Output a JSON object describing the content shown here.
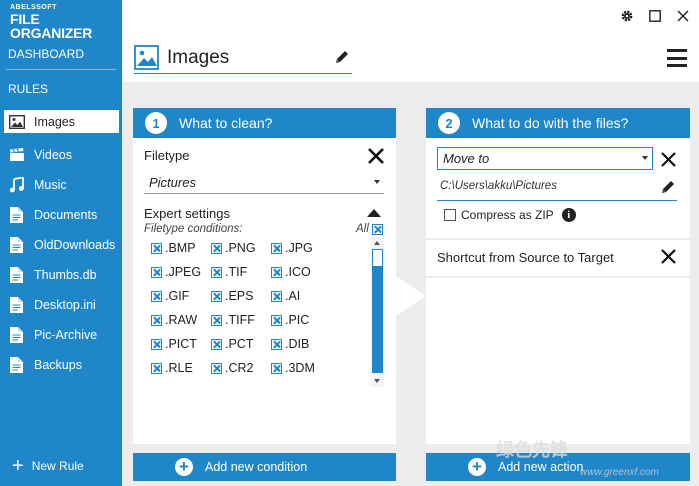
{
  "logo": {
    "small": "ABELSSOFT",
    "big": "FILE ORGANIZER"
  },
  "sidebar": {
    "dashboard": "DASHBOARD",
    "rules_header": "RULES",
    "items": [
      {
        "label": "Images",
        "icon": "image-icon",
        "active": true
      },
      {
        "label": "Videos",
        "icon": "clapper-icon"
      },
      {
        "label": "Music",
        "icon": "music-note-icon"
      },
      {
        "label": "Documents",
        "icon": "document-icon"
      },
      {
        "label": "OldDownloads",
        "icon": "document-icon"
      },
      {
        "label": "Thumbs.db",
        "icon": "document-icon"
      },
      {
        "label": "Desktop.ini",
        "icon": "document-icon"
      },
      {
        "label": "Pic-Archive",
        "icon": "document-icon"
      },
      {
        "label": "Backups",
        "icon": "document-icon"
      }
    ],
    "new_rule": "New Rule"
  },
  "header": {
    "title": "Images"
  },
  "what_to_clean": {
    "number": "1",
    "title": "What to clean?",
    "filetype_label": "Filetype",
    "filetype_value": "Pictures",
    "expert_label": "Expert settings",
    "conditions_label": "Filetype conditions:",
    "all_label": "All",
    "extensions": [
      ".BMP",
      ".PNG",
      ".JPG",
      ".JPEG",
      ".TIF",
      ".ICO",
      ".GIF",
      ".EPS",
      ".AI",
      ".RAW",
      ".TIFF",
      ".PIC",
      ".PICT",
      ".PCT",
      ".DIB",
      ".RLE",
      ".CR2",
      ".3DM"
    ],
    "add_button": "Add new condition"
  },
  "what_to_do": {
    "number": "2",
    "title": "What to do with the files?",
    "action_value": "Move to",
    "path": "C:\\Users\\akku\\Pictures",
    "compress_label": "Compress as ZIP",
    "info_glyph": "i",
    "shortcut_label": "Shortcut from Source to Target",
    "add_button": "Add new action"
  },
  "watermark": {
    "text": "绿色先锋",
    "url": "www.greenxf.com"
  },
  "colors": {
    "accent": "#1f87c9",
    "background": "#ececec"
  }
}
